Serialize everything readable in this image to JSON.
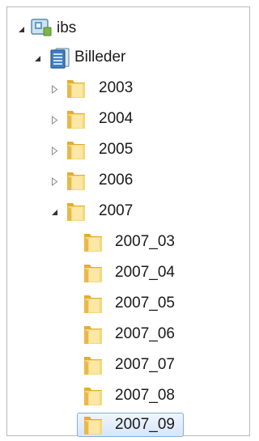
{
  "tree": {
    "root": {
      "label": "ibs",
      "expanded": true,
      "icon": "computer-user-icon"
    },
    "library": {
      "label": "Billeder",
      "expanded": true,
      "icon": "library-pictures-icon"
    },
    "years": [
      {
        "label": "2003",
        "expanded": false
      },
      {
        "label": "2004",
        "expanded": false
      },
      {
        "label": "2005",
        "expanded": false
      },
      {
        "label": "2006",
        "expanded": false
      },
      {
        "label": "2007",
        "expanded": true
      }
    ],
    "months": [
      {
        "label": "2007_03"
      },
      {
        "label": "2007_04"
      },
      {
        "label": "2007_05"
      },
      {
        "label": "2007_06"
      },
      {
        "label": "2007_07"
      },
      {
        "label": "2007_08"
      },
      {
        "label": "2007_09",
        "selected": true
      }
    ]
  },
  "colors": {
    "folder_light": "#f7d878",
    "folder_dark": "#e3ad32",
    "selection_border": "#84acdd",
    "selection_fill": "#dce9fb"
  }
}
